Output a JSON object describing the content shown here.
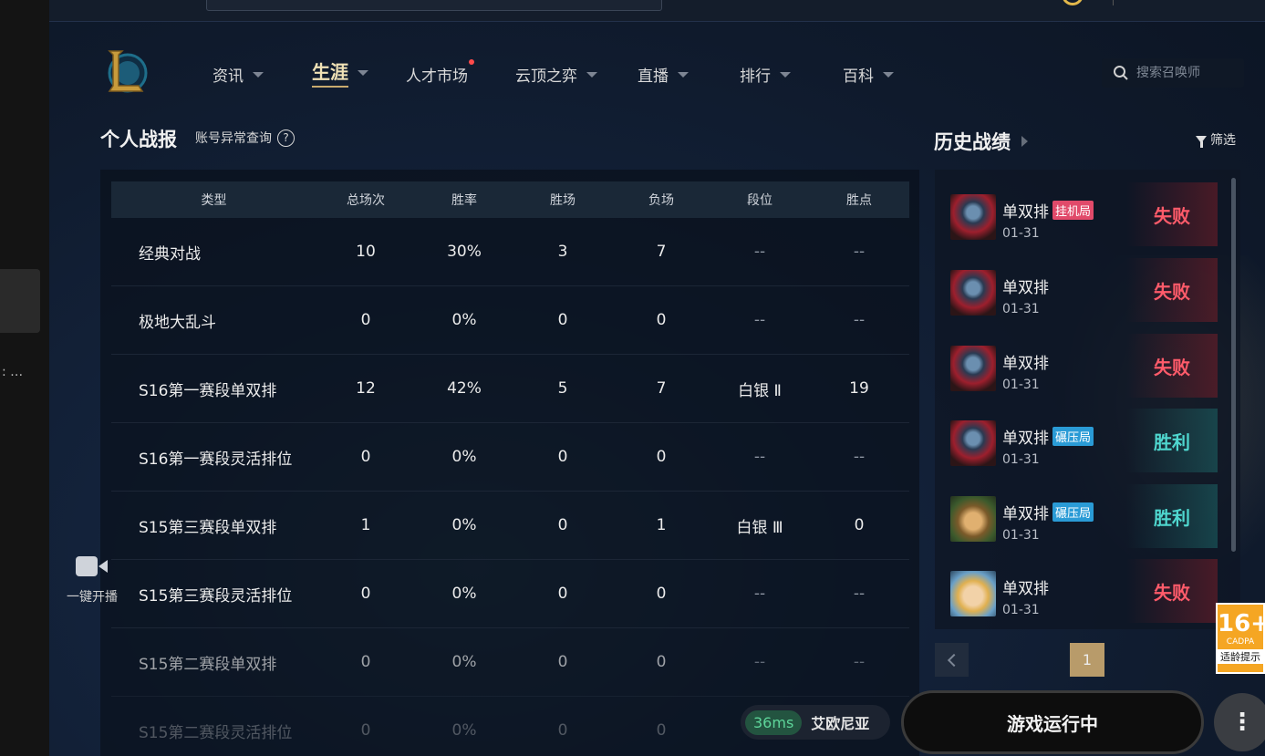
{
  "nav": {
    "items": [
      {
        "label": "资讯",
        "caret": true
      },
      {
        "label": "生涯",
        "caret": true,
        "active": true
      },
      {
        "label": "人才市场",
        "caret": false,
        "dot": true
      },
      {
        "label": "云顶之弈",
        "caret": true
      },
      {
        "label": "直播",
        "caret": true
      },
      {
        "label": "排行",
        "caret": true
      },
      {
        "label": "百科",
        "caret": true
      }
    ],
    "search_placeholder": "搜索召唤师"
  },
  "left_panel": {
    "ellipsis": ": …"
  },
  "stats": {
    "title": "个人战报",
    "link": "账号异常查询",
    "help": "?",
    "headers": [
      "类型",
      "总场次",
      "胜率",
      "胜场",
      "负场",
      "段位",
      "胜点"
    ],
    "rows": [
      [
        "经典对战",
        "10",
        "30%",
        "3",
        "7",
        "--",
        "--"
      ],
      [
        "极地大乱斗",
        "0",
        "0%",
        "0",
        "0",
        "--",
        "--"
      ],
      [
        "S16第一赛段单双排",
        "12",
        "42%",
        "5",
        "7",
        "白银 Ⅱ",
        "19"
      ],
      [
        "S16第一赛段灵活排位",
        "0",
        "0%",
        "0",
        "0",
        "--",
        "--"
      ],
      [
        "S15第三赛段单双排",
        "1",
        "0%",
        "0",
        "1",
        "白银 Ⅲ",
        "0"
      ],
      [
        "S15第三赛段灵活排位",
        "0",
        "0%",
        "0",
        "0",
        "--",
        "--"
      ],
      [
        "S15第二赛段单双排",
        "0",
        "0%",
        "0",
        "0",
        "--",
        "--"
      ],
      [
        "S15第二赛段灵活排位",
        "0",
        "0%",
        "0",
        "0",
        "--",
        "--"
      ]
    ]
  },
  "history": {
    "title": "历史战绩",
    "filter": "筛选",
    "items": [
      {
        "mode": "单双排",
        "tag": "挂机局",
        "tag_color": "#e14a6a",
        "date": "01-31",
        "result": "失败",
        "win": false,
        "champ": "a"
      },
      {
        "mode": "单双排",
        "tag": "",
        "date": "01-31",
        "result": "失败",
        "win": false,
        "champ": "a"
      },
      {
        "mode": "单双排",
        "tag": "",
        "date": "01-31",
        "result": "失败",
        "win": false,
        "champ": "a"
      },
      {
        "mode": "单双排",
        "tag": "碾压局",
        "tag_color": "#2a9bd6",
        "date": "01-31",
        "result": "胜利",
        "win": true,
        "champ": "a"
      },
      {
        "mode": "单双排",
        "tag": "碾压局",
        "tag_color": "#2a9bd6",
        "date": "01-31",
        "result": "胜利",
        "win": true,
        "champ": "b"
      },
      {
        "mode": "单双排",
        "tag": "",
        "date": "01-31",
        "result": "失败",
        "win": false,
        "champ": "c"
      }
    ],
    "page": "1"
  },
  "footer": {
    "latency": "36ms",
    "region": "艾欧尼亚",
    "game_status": "游戏运行中",
    "stream_label": "一键开播",
    "more": "⋮"
  },
  "age_badge": {
    "num": "16+",
    "org": "CADPA",
    "tip": "适龄提示"
  },
  "colors": {
    "accent_gold": "#c8aa6e",
    "lose": "#ff5b6a",
    "win": "#4fd7cf",
    "latency_green": "#5ed59a"
  }
}
